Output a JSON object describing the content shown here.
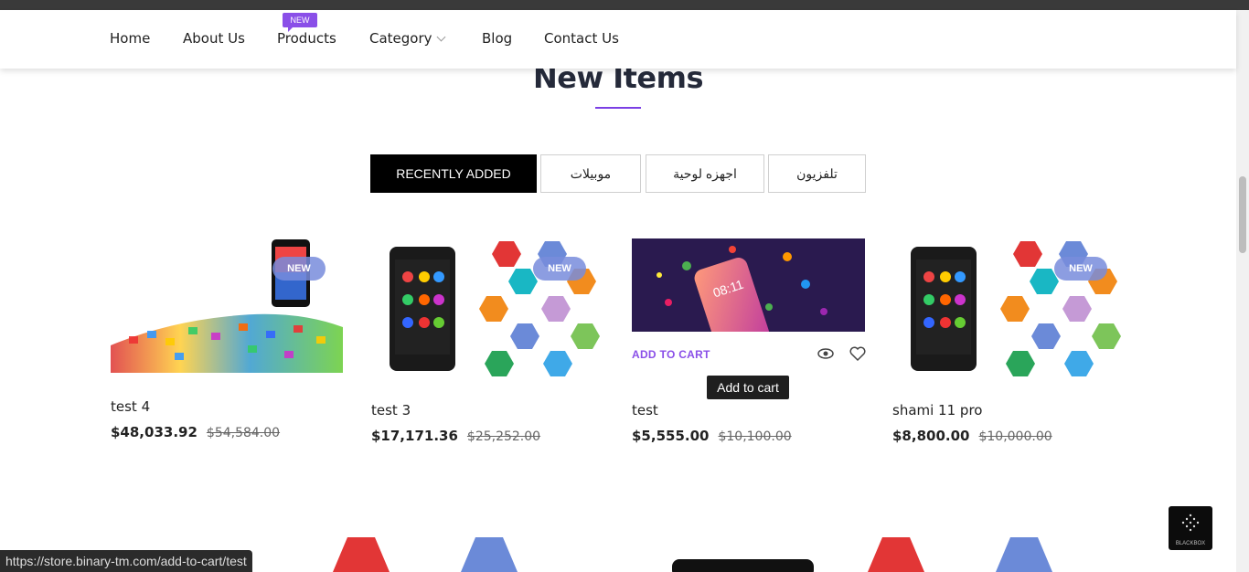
{
  "nav": {
    "items": [
      "Home",
      "About Us",
      "Products",
      "Category",
      "Blog",
      "Contact Us"
    ],
    "products_badge": "NEW"
  },
  "section": {
    "title": "New Items"
  },
  "tabs": [
    "RECENTLY ADDED",
    "موبيلات",
    "اجهزه لوحية",
    "تلفزيون"
  ],
  "products": [
    {
      "name": "test 4",
      "price": "$48,033.92",
      "old_price": "$54,584.00",
      "badge": "NEW"
    },
    {
      "name": "test 3",
      "price": "$17,171.36",
      "old_price": "$25,252.00",
      "badge": "NEW"
    },
    {
      "name": "test",
      "price": "$5,555.00",
      "old_price": "$10,100.00",
      "badge": ""
    },
    {
      "name": "shami 11 pro",
      "price": "$8,800.00",
      "old_price": "$10,000.00",
      "badge": "NEW"
    }
  ],
  "hover_actions": {
    "add_to_cart": "ADD TO CART",
    "tooltip": "Add to cart"
  },
  "phone_screen_time": "08:11",
  "status_url": "https://store.binary-tm.com/add-to-cart/test",
  "blackbox_label": "BLACKBOX",
  "colors": {
    "accent": "#8a4fe8",
    "nav_badge": "#8a4fe8",
    "tab_active": "#000000",
    "title": "#252a3a"
  }
}
